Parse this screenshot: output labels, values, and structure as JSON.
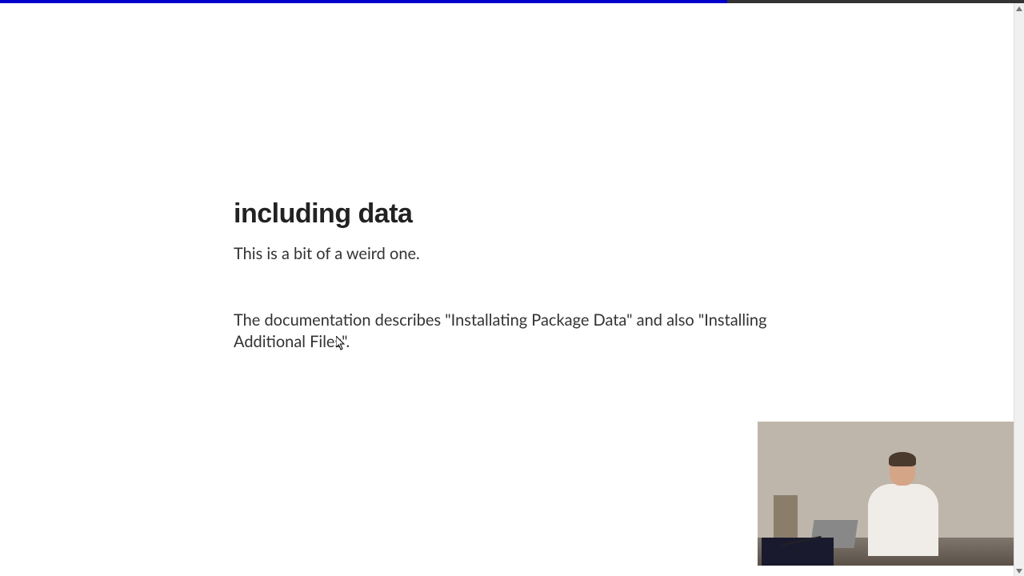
{
  "slide": {
    "heading": "including data",
    "paragraph1": "This is a bit of a weird one.",
    "paragraph2": "The documentation describes \"Installating Package Data\" and also \"Installing Additional Files\"."
  },
  "progress": {
    "percent": 71
  }
}
